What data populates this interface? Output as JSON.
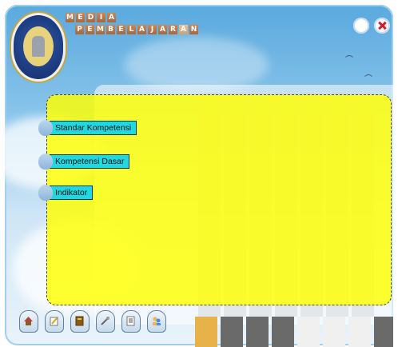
{
  "header": {
    "title_row1": [
      "M",
      "E",
      "D",
      "I",
      "A"
    ],
    "title_row2": [
      "P",
      "E",
      "M",
      "B",
      "E",
      "L",
      "A",
      "J",
      "A",
      "R",
      "A",
      "N"
    ],
    "highlight_index": 10
  },
  "logo": {
    "icon": "university-emblem-icon"
  },
  "top_buttons": [
    {
      "name": "info-button",
      "icon": "circle-icon"
    },
    {
      "name": "close-button",
      "icon": "close-icon",
      "color": "#d8192f"
    }
  ],
  "menu": [
    {
      "label": "Standar Kompetensi"
    },
    {
      "label": "Kompetensi Dasar"
    },
    {
      "label": "Indikator"
    }
  ],
  "bottom_nav": [
    {
      "name": "home",
      "icon": "home-icon"
    },
    {
      "name": "edit",
      "icon": "pencil-icon"
    },
    {
      "name": "book",
      "icon": "book-icon"
    },
    {
      "name": "tools",
      "icon": "wrench-icon"
    },
    {
      "name": "document",
      "icon": "document-icon"
    },
    {
      "name": "users",
      "icon": "users-icon"
    }
  ],
  "colors": {
    "panel": "#ffff00",
    "label": "#22d8de",
    "accent": "#d8192f"
  }
}
